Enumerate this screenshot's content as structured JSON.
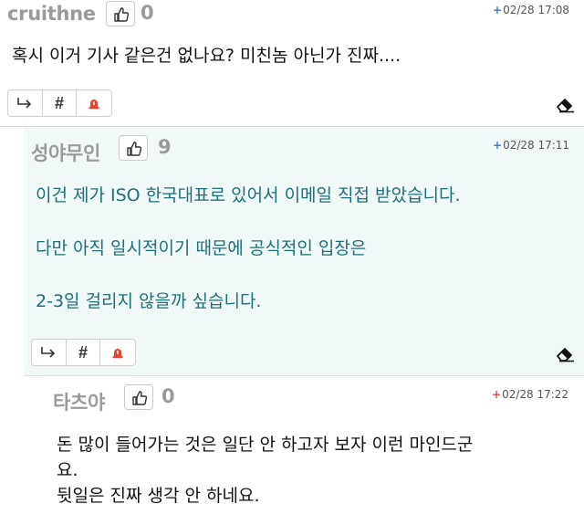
{
  "comments": [
    {
      "nickname": "cruithne",
      "likes": "0",
      "date_icon": "+",
      "date": "02/28 17:08",
      "paragraphs": [
        "혹시 이거 기사 같은건 없나요? 미친놈 아닌가 진짜...."
      ]
    },
    {
      "nickname": "성야무인",
      "likes": "9",
      "date_icon": "+",
      "date": "02/28 17:11",
      "paragraphs": [
        "이건 제가 ISO 한국대표로 있어서 이메일 직접 받았습니다.",
        "다만 아직 일시적이기 때문에 공식적인 입장은",
        "2-3일 걸리지 않을까 싶습니다."
      ]
    },
    {
      "nickname": "타츠야",
      "likes": "0",
      "date_icon": "+",
      "date": "02/28 17:22",
      "paragraphs": [
        "돈 많이 들어가는 것은 일단 안 하고자 보자 이런 마인드군",
        "요.",
        "뒷일은 진짜 생각 안 하네요."
      ]
    }
  ],
  "toolbar": {
    "reply_icon": "reply-arrow-icon",
    "hash_label": "#",
    "report_icon": "siren-icon",
    "edit_icon": "eraser-icon"
  },
  "colors": {
    "nickname": "#9a9a9a",
    "reply_body_text": "#1f6f78",
    "reply_background": "#f1f8f8",
    "date_plus_blue": "#3a7bd5",
    "date_plus_red": "#d9534f",
    "siren": "#e2442f"
  }
}
